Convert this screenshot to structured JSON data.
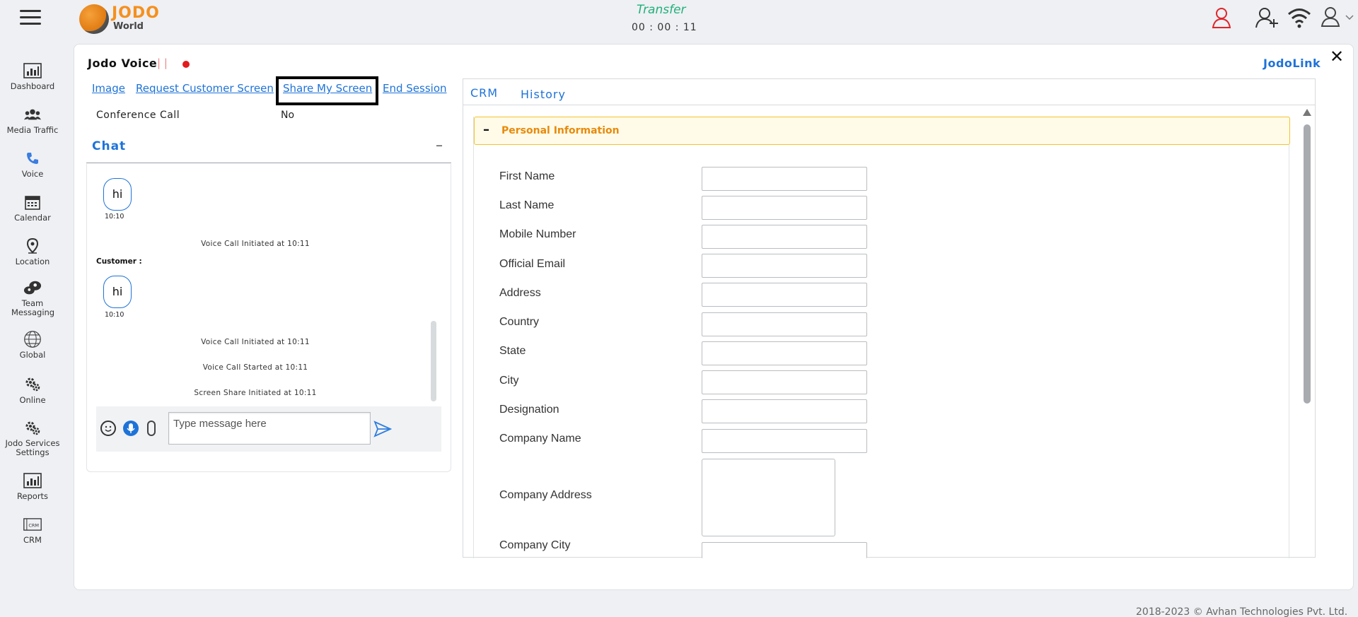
{
  "header": {
    "logo_top": "JODO",
    "logo_bottom": "World",
    "status": "Transfer",
    "timer": "00 : 00 : 11"
  },
  "sidebar": {
    "items": [
      {
        "label": "Dashboard",
        "icon": "dashboard-icon"
      },
      {
        "label": "Media Traffic",
        "icon": "media-traffic-icon"
      },
      {
        "label": "Voice",
        "icon": "phone-icon"
      },
      {
        "label": "Calendar",
        "icon": "calendar-icon"
      },
      {
        "label": "Location",
        "icon": "location-pin-icon"
      },
      {
        "label": "Team Messaging",
        "icon": "team-messaging-icon"
      },
      {
        "label": "Global",
        "icon": "globe-icon"
      },
      {
        "label": "Online",
        "icon": "gears-icon"
      },
      {
        "label": "Jodo Services Settings",
        "icon": "gears-icon"
      },
      {
        "label": "Reports",
        "icon": "reports-icon"
      },
      {
        "label": "CRM",
        "icon": "crm-icon"
      }
    ]
  },
  "voice": {
    "title": "Jodo Voice",
    "separator": "| |",
    "jodolink": "JodoLink",
    "links": {
      "image": "Image",
      "request_screen": "Request Customer Screen",
      "share_screen": "Share My Screen",
      "end_session": "End Session"
    },
    "conference_label": "Conference Call",
    "conference_value": "No"
  },
  "chat": {
    "title": "Chat",
    "minimize": "–",
    "msg1_text": "hi",
    "msg1_time": "10:10",
    "sys1": "Voice Call Initiated at 10:11",
    "customer_label": "Customer :",
    "msg2_text": "hi",
    "msg2_time": "10:10",
    "sys2": "Voice Call Initiated at 10:11",
    "sys3": "Voice Call Started at 10:11",
    "sys4": "Screen Share Initiated at 10:11",
    "input_placeholder": "Type message here"
  },
  "crm": {
    "tabs": [
      "CRM",
      "History"
    ],
    "section_title": "Personal Information",
    "fields": {
      "first_name": "First Name",
      "last_name": "Last Name",
      "mobile": "Mobile Number",
      "email": "Official Email",
      "address": "Address",
      "country": "Country",
      "state": "State",
      "city": "City",
      "designation": "Designation",
      "company_name": "Company Name",
      "company_address": "Company Address",
      "company_city": "Company City"
    }
  },
  "footer": "2018-2023 © Avhan Technologies Pvt. Ltd."
}
